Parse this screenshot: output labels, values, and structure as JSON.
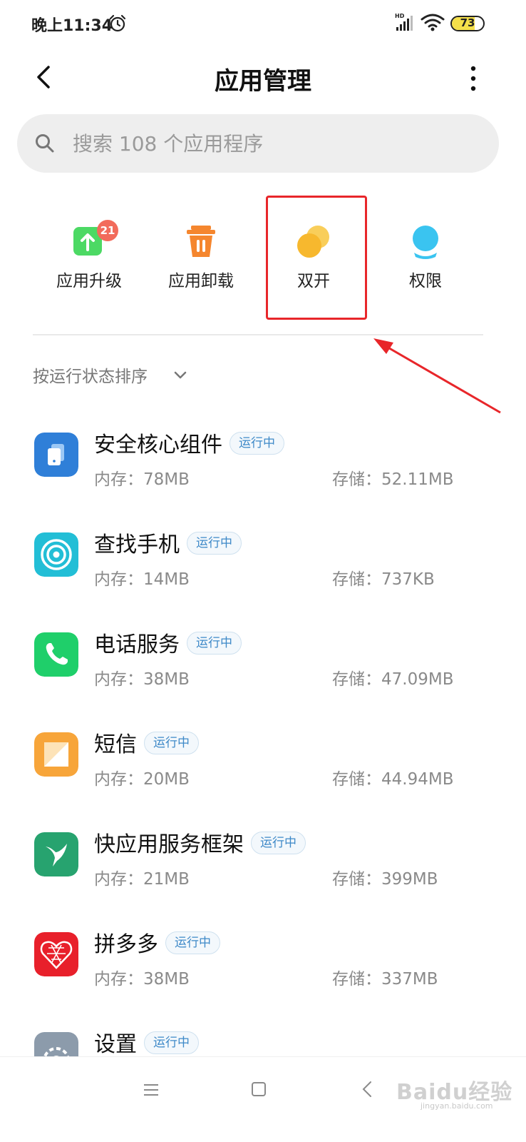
{
  "status_bar": {
    "time": "晚上11:34",
    "hd_label": "HD",
    "battery": "73",
    "battery_level": 0.73
  },
  "header": {
    "title": "应用管理"
  },
  "search": {
    "placeholder": "搜索 108 个应用程序"
  },
  "quick_actions": [
    {
      "label": "应用升级",
      "icon": "upgrade-icon",
      "badge": "21",
      "color": "#4cd964"
    },
    {
      "label": "应用卸载",
      "icon": "trash-icon",
      "color": "#f5862e"
    },
    {
      "label": "双开",
      "icon": "dual-app-icon",
      "color": "#f7c23a"
    },
    {
      "label": "权限",
      "icon": "permission-icon",
      "color": "#3ac4f0"
    }
  ],
  "sort": {
    "label": "按运行状态排序"
  },
  "apps": [
    {
      "name": "安全核心组件",
      "status": "运行中",
      "memory": "内存：78MB",
      "storage": "存储：52.11MB",
      "icon": "security-component-icon"
    },
    {
      "name": "查找手机",
      "status": "运行中",
      "memory": "内存：14MB",
      "storage": "存储：737KB",
      "icon": "find-phone-icon"
    },
    {
      "name": "电话服务",
      "status": "运行中",
      "memory": "内存：38MB",
      "storage": "存储：47.09MB",
      "icon": "phone-icon"
    },
    {
      "name": "短信",
      "status": "运行中",
      "memory": "内存：20MB",
      "storage": "存储：44.94MB",
      "icon": "sms-icon"
    },
    {
      "name": "快应用服务框架",
      "status": "运行中",
      "memory": "内存：21MB",
      "storage": "存储：399MB",
      "icon": "quick-app-icon"
    },
    {
      "name": "拼多多",
      "status": "运行中",
      "memory": "内存：38MB",
      "storage": "存储：337MB",
      "icon": "pinduoduo-icon"
    },
    {
      "name": "设置",
      "status": "运行中",
      "memory": "",
      "storage": "",
      "icon": "settings-icon"
    }
  ],
  "watermark": {
    "text": "Baidu经验",
    "sub": "jingyan.baidu.com"
  },
  "colors": {
    "accent": "#3e89c8",
    "highlight": "#e8262a"
  }
}
